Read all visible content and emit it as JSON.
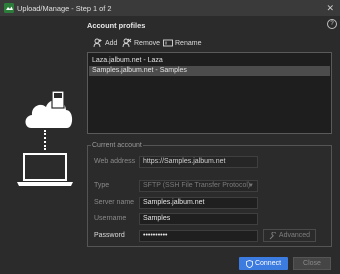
{
  "window": {
    "title": "Upload/Manage - Step 1 of 2",
    "close_glyph": "✕",
    "help_glyph": "?"
  },
  "profiles": {
    "heading": "Account profiles",
    "toolbar": {
      "add": "Add",
      "remove": "Remove",
      "rename": "Rename"
    },
    "items": [
      {
        "label": "Laza.jalbum.net - Laza",
        "selected": false
      },
      {
        "label": "Samples.jalbum.net - Samples",
        "selected": true
      }
    ]
  },
  "account": {
    "legend": "Current account",
    "web_address": {
      "label": "Web address",
      "value": "https://Samples.jalbum.net"
    },
    "type": {
      "label": "Type",
      "value": "SFTP (SSH File Transfer Protocol)"
    },
    "server_name": {
      "label": "Server name",
      "value": "Samples.jalbum.net"
    },
    "username": {
      "label": "Username",
      "value": "Samples"
    },
    "password": {
      "label": "Password",
      "value": "••••••••••"
    },
    "advanced_label": "Advanced"
  },
  "footer": {
    "connect_label": "Connect",
    "close_label": "Close"
  },
  "colors": {
    "accent": "#3c7be0",
    "background": "#2b2b2b",
    "selected_row": "#4c4c4c"
  }
}
